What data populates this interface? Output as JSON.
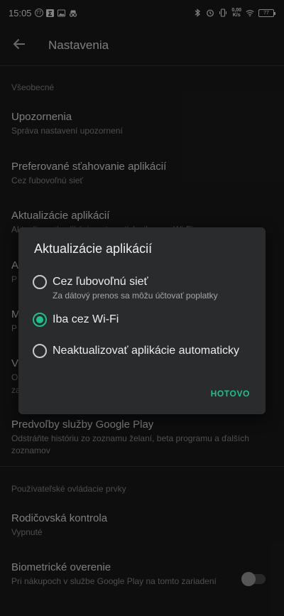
{
  "status_bar": {
    "time": "15:05",
    "badge": "77",
    "speed_value": "0,00",
    "speed_unit": "K/s",
    "battery": "77"
  },
  "appbar": {
    "title": "Nastavenia"
  },
  "sections": {
    "general_header": "Všeobecné",
    "user_controls_header": "Používateľské ovládacie prvky"
  },
  "rows": [
    {
      "title": "Upozornenia",
      "subtitle": "Správa nastavení upozornení"
    },
    {
      "title": "Preferované sťahovanie aplikácií",
      "subtitle": "Cez ľubovoľnú sieť"
    },
    {
      "title": "Aktualizácie aplikácií",
      "subtitle": "Aktualizovať aplikácie automaticky iba cez Wi-Fi"
    },
    {
      "title": "Predvoľby služby Google Play",
      "subtitle": "Odstráňte históriu zo zoznamu želaní, beta programu a ďalších zoznamov"
    },
    {
      "title": "Rodičovská kontrola",
      "subtitle": "Vypnuté"
    },
    {
      "title": "Biometrické overenie",
      "subtitle": "Pri nákupoch v službe Google Play na tomto zariadení"
    }
  ],
  "partial_rows": [
    "A",
    "P",
    "M",
    "P",
    "V",
    "O",
    "za"
  ],
  "biometric_toggle": {
    "on": false
  },
  "dialog": {
    "title": "Aktualizácie aplikácií",
    "options": [
      {
        "label": "Cez ľubovoľnú sieť",
        "sublabel": "Za dátový prenos sa môžu účtovať poplatky",
        "selected": false
      },
      {
        "label": "Iba cez Wi-Fi",
        "selected": true
      },
      {
        "label": "Neaktualizovať aplikácie automaticky",
        "selected": false
      }
    ],
    "done_label": "HOTOVO"
  },
  "colors": {
    "accent": "#1dc08a",
    "background": "#1b1b1c",
    "dialog": "#2a2b2d"
  }
}
